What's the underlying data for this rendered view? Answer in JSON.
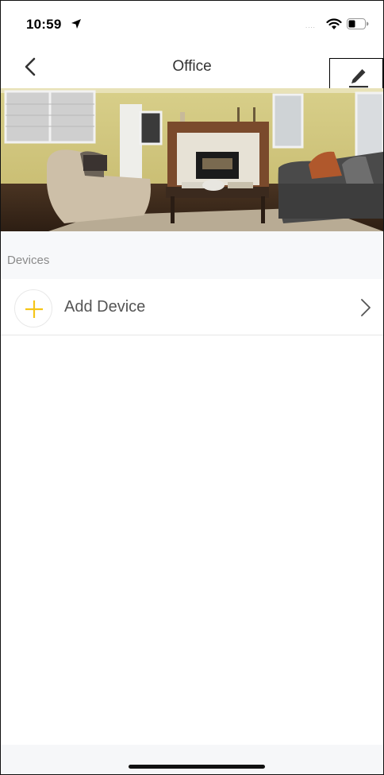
{
  "status_bar": {
    "time": "10:59",
    "signal_dots": "....",
    "icons": [
      "location-arrow-icon",
      "wifi-icon",
      "battery-icon"
    ]
  },
  "nav": {
    "title": "Office",
    "back_icon": "chevron-left-icon",
    "edit_icon": "pencil-icon"
  },
  "room": {
    "photo": "living-room-photo"
  },
  "devices": {
    "section_title": "Devices",
    "add_device_label": "Add Device",
    "add_icon": "plus-icon",
    "chevron_icon": "chevron-right-icon"
  },
  "colors": {
    "accent": "#f5c518",
    "section_bg": "#f7f8fa",
    "text": "#333333"
  }
}
